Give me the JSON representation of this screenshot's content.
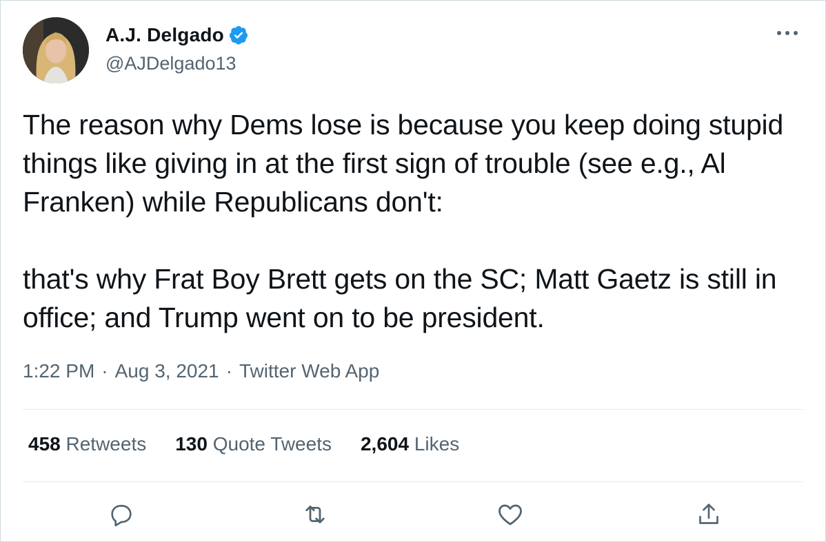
{
  "user": {
    "name": "A.J. Delgado",
    "handle": "@AJDelgado13",
    "verified": true
  },
  "tweet": {
    "text": "The reason why Dems lose is because you keep doing stupid things like giving in at the first sign of trouble (see e.g., Al Franken) while Republicans don't:\n\nthat's why Frat Boy Brett gets on the SC; Matt Gaetz is still in office; and Trump went on to be president."
  },
  "meta": {
    "time": "1:22 PM",
    "sep1": "·",
    "date": "Aug 3, 2021",
    "sep2": "·",
    "source": "Twitter Web App"
  },
  "stats": {
    "retweets_count": "458",
    "retweets_label": "Retweets",
    "quotes_count": "130",
    "quotes_label": "Quote Tweets",
    "likes_count": "2,604",
    "likes_label": "Likes"
  },
  "icons": {
    "more": "more-icon",
    "reply": "reply-icon",
    "retweet": "retweet-icon",
    "like": "like-icon",
    "share": "share-icon",
    "verified": "verified-badge-icon"
  },
  "colors": {
    "text": "#0f1419",
    "secondary": "#536471",
    "verified": "#1d9bf0",
    "divider": "#e6ecf0"
  }
}
